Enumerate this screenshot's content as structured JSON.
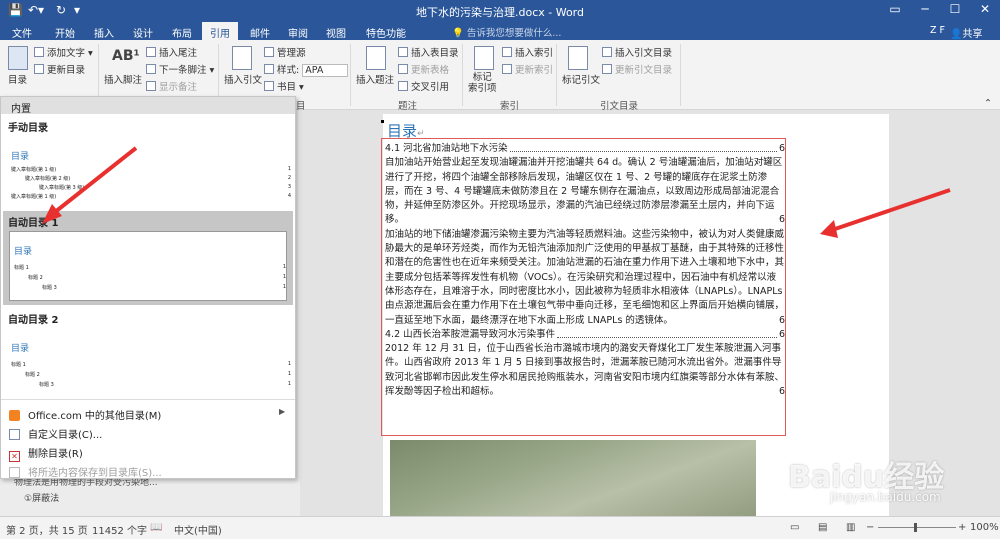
{
  "app": {
    "title": "地下水的污染与治理.docx - Word",
    "user": "Z F",
    "share": "共享",
    "tell_me": "告诉我您想要做什么..."
  },
  "tabs": [
    "文件",
    "开始",
    "插入",
    "设计",
    "布局",
    "引用",
    "邮件",
    "审阅",
    "视图",
    "特色功能"
  ],
  "ribbon": {
    "toc_label": "目录",
    "add_text": "添加文字",
    "update_table": "更新目录",
    "insert_footnote": "插入脚注",
    "insert_endnote": "插入尾注",
    "next_footnote": "下一条脚注",
    "show_notes": "显示备注",
    "insert_citation": "插入引文",
    "manage_sources": "管理源",
    "style_label": "样式:",
    "style_value": "APA",
    "bibliography": "书目",
    "insert_caption": "插入题注",
    "insert_table_of_figures": "插入表目录",
    "update_table2": "更新表格",
    "cross_reference": "交叉引用",
    "mark_entry": "标记\n索引项",
    "insert_index": "插入索引",
    "update_index": "更新索引",
    "mark_citation": "标记引文",
    "insert_table_of_authorities": "插入引文目录",
    "update_table3": "更新引文目录",
    "groups": {
      "references": "引文与书目",
      "captions": "题注",
      "index": "索引",
      "authorities": "引文目录",
      "toc": "目"
    }
  },
  "toc_menu": {
    "header": "内置",
    "manual_title": "手动目录",
    "auto1_title": "自动目录 1",
    "auto2_title": "自动目录 2",
    "preview_heading": "目录",
    "manual_rows": [
      {
        "text": "键入章标题(第 1 级)",
        "page": "1"
      },
      {
        "text": "键入章标题(第 2 级)",
        "page": "2"
      },
      {
        "text": "键入章标题(第 3 级)",
        "page": "3"
      },
      {
        "text": "键入章标题(第 1 级)",
        "page": "4"
      }
    ],
    "auto_rows": [
      {
        "text": "标题 1",
        "page": "1"
      },
      {
        "text": "标题 2",
        "page": "1"
      },
      {
        "text": "标题 3",
        "page": "1"
      }
    ],
    "items": [
      "Office.com 中的其他目录(M)",
      "自定义目录(C)...",
      "删除目录(R)",
      "将所选内容保存到目录库(S)..."
    ]
  },
  "hidden_text": {
    "line1": "物理法是用物理的手段对受污染地...",
    "line2": "①屏蔽法"
  },
  "document": {
    "title": "目录",
    "entries": [
      {
        "text": "4.1 河北省加油站地下水污染",
        "page": "6"
      },
      {
        "text": "自加油站开始营业起至发现油罐漏油并开挖油罐共 64 d。确认 2 号油罐漏油后，加油站对罐区进行了开挖，将四个油罐全部移除后发现，油罐区仅在 1 号、2 号罐的罐底存在泥浆土防渗层，而在 3 号、4 号罐罐底未做防渗且在 2 号罐东侧存在漏油点，以致周边形成局部油泥混合物，并延伸至防渗区外。开挖现场显示，渗漏的汽油已经绕过防渗层渗漏至土层内，并向下运移。",
        "page": "6"
      },
      {
        "text": "加油站的地下储油罐渗漏污染物主要为汽油等轻质燃料油。这些污染物中，被认为对人类健康威胁最大的是单环芳烃类，而作为无铅汽油添加剂广泛使用的甲基叔丁基醚，由于其特殊的迁移性和潜在的危害性也在近年来频受关注。加油站泄漏的石油在重力作用下进入土壤和地下水中，其主要成分包括苯等挥发性有机物（VOCs）。在污染研究和治理过程中，因石油中有机烃常以液体形态存在，且难溶于水，同时密度比水小，因此被称为轻质非水相液体（LNAPLs）。LNAPLs 由点源泄漏后会在重力作用下在土壤包气带中垂向迁移，至毛细饱和区上界面后开始横向铺展，一直延至地下水面，最终漂浮在地下水面上形成 LNAPLs 的透镜体。",
        "page": "6"
      },
      {
        "text": "4.2 山西长治苯胺泄漏导致河水污染事件",
        "page": "6"
      },
      {
        "text": "2012 年 12 月 31 日，位于山西省长治市潞城市境内的潞安天脊煤化工厂发生苯胺泄漏入河事件。山西省政府 2013 年 1 月 5 日接到事故报告时，泄漏苯胺已随河水流出省外。泄漏事件导致河北省邯郸市因此发生停水和居民抢购瓶装水，河南省安阳市境内红旗渠等部分水体有苯胺、挥发酚等因子检出和超标。",
        "page": "6"
      }
    ]
  },
  "status": {
    "page": "第 2 页，共 15 页",
    "words": "11452 个字",
    "lang": "中文(中国)",
    "zoom": "100%"
  },
  "watermark": {
    "brand": "Baidu经验",
    "url": "jingyan.baidu.com"
  },
  "colors": {
    "word_blue": "#2b579a",
    "arrow_red": "#e8312f",
    "toc_blue": "#2e74b5",
    "border_red": "#e05a5a"
  }
}
